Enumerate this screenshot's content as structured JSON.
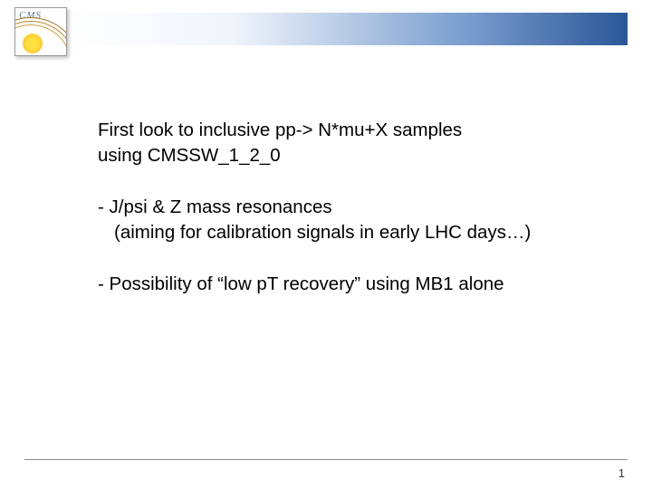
{
  "logo": {
    "label": "CMS"
  },
  "content": {
    "line1": "First look to inclusive pp-> N*mu+X samples",
    "line2": "using CMSSW_1_2_0",
    "line3": "",
    "line4": "- J/psi &  Z mass resonances",
    "line5": "  (aiming for calibration signals in early LHC days…)",
    "line6": "",
    "line7": "- Possibility of “low pT recovery” using MB1 alone"
  },
  "page": {
    "number": "1"
  }
}
